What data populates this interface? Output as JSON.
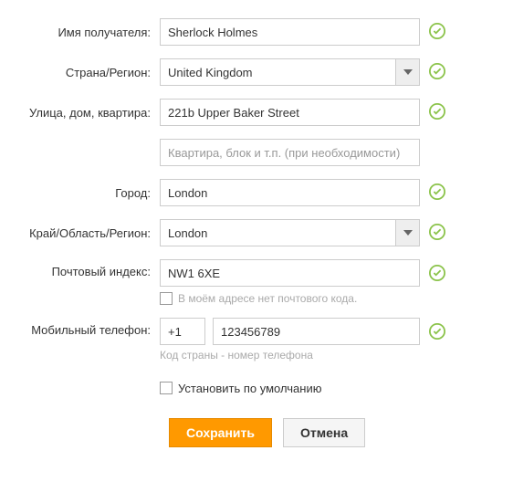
{
  "labels": {
    "recipient": "Имя получателя:",
    "country": "Страна/Регион:",
    "street": "Улица, дом, квартира:",
    "city": "Город:",
    "region": "Край/Область/Регион:",
    "postal": "Почтовый индекс:",
    "phone": "Мобильный телефон:"
  },
  "values": {
    "recipient": "Sherlock Holmes",
    "country": "United Kingdom",
    "street": "221b Upper Baker Street",
    "apartment": "",
    "city": "London",
    "region": "London",
    "postal": "NW1 6XE",
    "phone_code": "+1",
    "phone_number": "123456789"
  },
  "placeholders": {
    "apartment": "Квартира, блок и т.п. (при необходимости)"
  },
  "hints": {
    "no_postal": "В моём адресе нет почтового кода.",
    "phone": "Код страны - номер телефона",
    "set_default": "Установить по умолчанию"
  },
  "buttons": {
    "save": "Сохранить",
    "cancel": "Отмена"
  },
  "colors": {
    "accent": "#f90",
    "valid": "#8bc34a"
  }
}
